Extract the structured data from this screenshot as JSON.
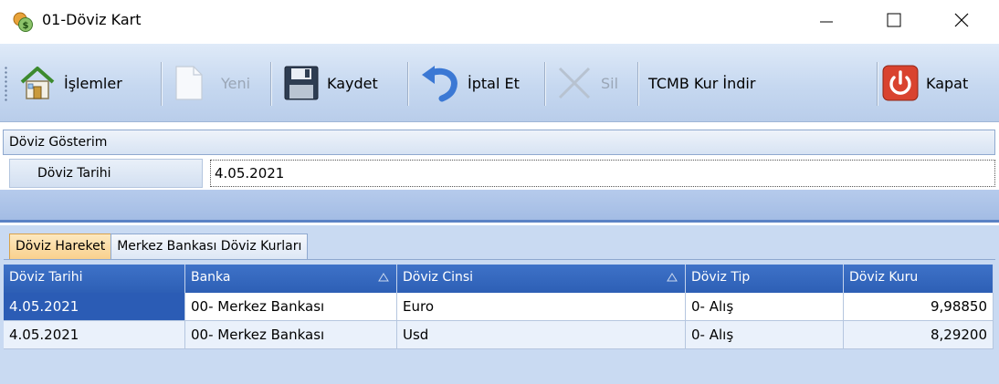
{
  "window": {
    "title": "01-Döviz Kart",
    "minimize_glyph": "—",
    "maximize_glyph": "☐",
    "close_glyph": "✕"
  },
  "toolbar": {
    "islemler": "İşlemler",
    "yeni": "Yeni",
    "kaydet": "Kaydet",
    "iptal": "İptal Et",
    "sil": "Sil",
    "tcmb": "TCMB Kur İndir",
    "kapat": "Kapat"
  },
  "form": {
    "group_title": "Döviz Gösterim",
    "date_label": "Döviz Tarihi",
    "date_value": "4.05.2021"
  },
  "tabs": [
    {
      "label": "Döviz Hareket",
      "active": true
    },
    {
      "label": "Merkez Bankası Döviz Kurları",
      "active": false
    }
  ],
  "grid": {
    "columns": [
      "Döviz Tarihi",
      "Banka",
      "Döviz Cinsi",
      "Döviz Tip",
      "Döviz Kuru"
    ],
    "rows": [
      [
        "4.05.2021",
        "00- Merkez Bankası",
        "Euro",
        "0- Alış",
        "9,98850"
      ],
      [
        "4.05.2021",
        "00- Merkez Bankası",
        "Usd",
        "0- Alış",
        "8,29200"
      ]
    ]
  },
  "icons": {
    "app": "currency-coins-icon",
    "islemler": "house-icon",
    "yeni": "new-document-icon",
    "kaydet": "floppy-disk-icon",
    "iptal": "undo-arrow-icon",
    "sil": "delete-x-icon",
    "kapat": "power-icon",
    "sort": "sort-triangle-icon"
  },
  "colors": {
    "grid_header": "#2d5fb5",
    "selection": "#2b5cb5",
    "active_tab": "#f9d08c",
    "close_button": "#d9432f"
  }
}
